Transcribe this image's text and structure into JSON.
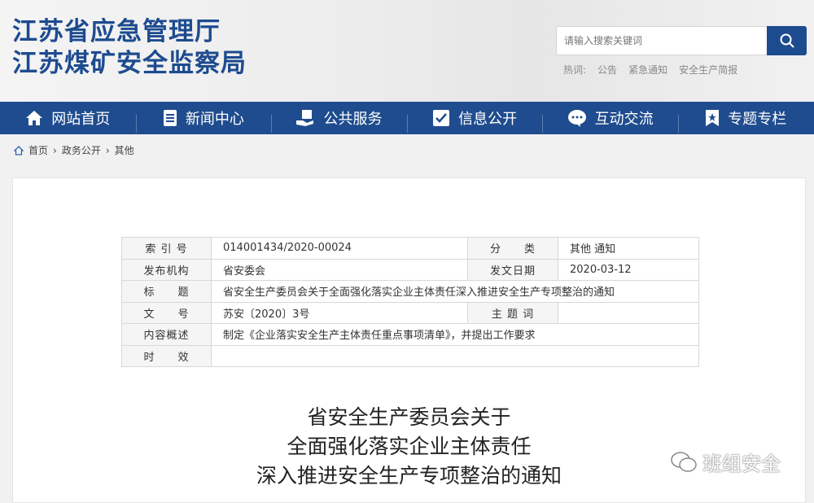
{
  "header": {
    "title_line1": "江苏省应急管理厅",
    "title_line2": "江苏煤矿安全监察局",
    "search_placeholder": "请输入搜索关键词",
    "hot_label": "热词:",
    "hot_words": [
      "公告",
      "紧急通知",
      "安全生产简报"
    ]
  },
  "nav": [
    {
      "label": "网站首页",
      "icon": "home-icon"
    },
    {
      "label": "新闻中心",
      "icon": "news-icon"
    },
    {
      "label": "公共服务",
      "icon": "service-icon"
    },
    {
      "label": "信息公开",
      "icon": "info-icon"
    },
    {
      "label": "互动交流",
      "icon": "chat-icon"
    },
    {
      "label": "专题专栏",
      "icon": "bookmark-icon"
    }
  ],
  "breadcrumb": [
    "首页",
    "政务公开",
    "其他"
  ],
  "meta": {
    "index_label": "索 引 号",
    "index": "014001434/2020-00024",
    "category_label": "分　　类",
    "category": "其他 通知",
    "publisher_label": "发布机构",
    "publisher": "省安委会",
    "date_label": "发文日期",
    "date": "2020-03-12",
    "title_label": "标　　题",
    "title": "省安全生产委员会关于全面强化落实企业主体责任深入推进安全生产专项整治的通知",
    "docno_label": "文　　号",
    "docno": "苏安〔2020〕3号",
    "keywords_label": "主 题 词",
    "keywords": "",
    "summary_label": "内容概述",
    "summary": "制定《企业落实安全生产主体责任重点事项清单》，并提出工作要求",
    "validity_label": "时　　效",
    "validity": ""
  },
  "article": {
    "title_lines": [
      "省安全生产委员会关于",
      "全面强化落实企业主体责任",
      "深入推进安全生产专项整治的通知"
    ]
  },
  "watermark": "班组安全"
}
